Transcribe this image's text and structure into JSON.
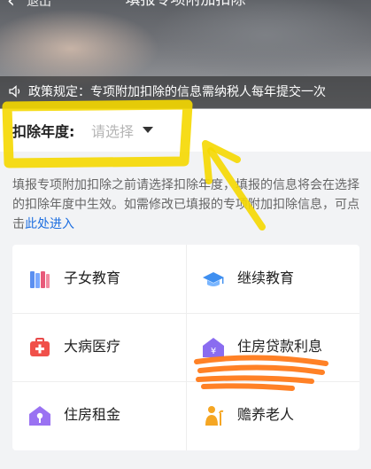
{
  "header": {
    "back_label": "退出",
    "title": "填报专项附加扣除"
  },
  "notice": {
    "text": "政策规定：专项附加扣除的信息需纳税人每年提交一次"
  },
  "year": {
    "label": "扣除年度:",
    "placeholder": "请选择"
  },
  "description": {
    "text": "填报专项附加扣除之前请选择扣除年度，填报的信息将会在选择的扣除年度中生效。如需修改已填报的专项附加扣除信息，可点击",
    "link": "此处进入"
  },
  "categories": [
    {
      "label": "子女教育",
      "icon": "books-icon"
    },
    {
      "label": "继续教育",
      "icon": "graduation-cap-icon"
    },
    {
      "label": "大病医疗",
      "icon": "medical-kit-icon"
    },
    {
      "label": "住房贷款利息",
      "icon": "house-yuan-icon"
    },
    {
      "label": "住房租金",
      "icon": "house-key-icon"
    },
    {
      "label": "赡养老人",
      "icon": "elder-icon"
    }
  ],
  "colors": {
    "link": "#1e6fe0",
    "highlight_yellow": "#f5d800",
    "highlight_orange": "#ff7a1a"
  }
}
